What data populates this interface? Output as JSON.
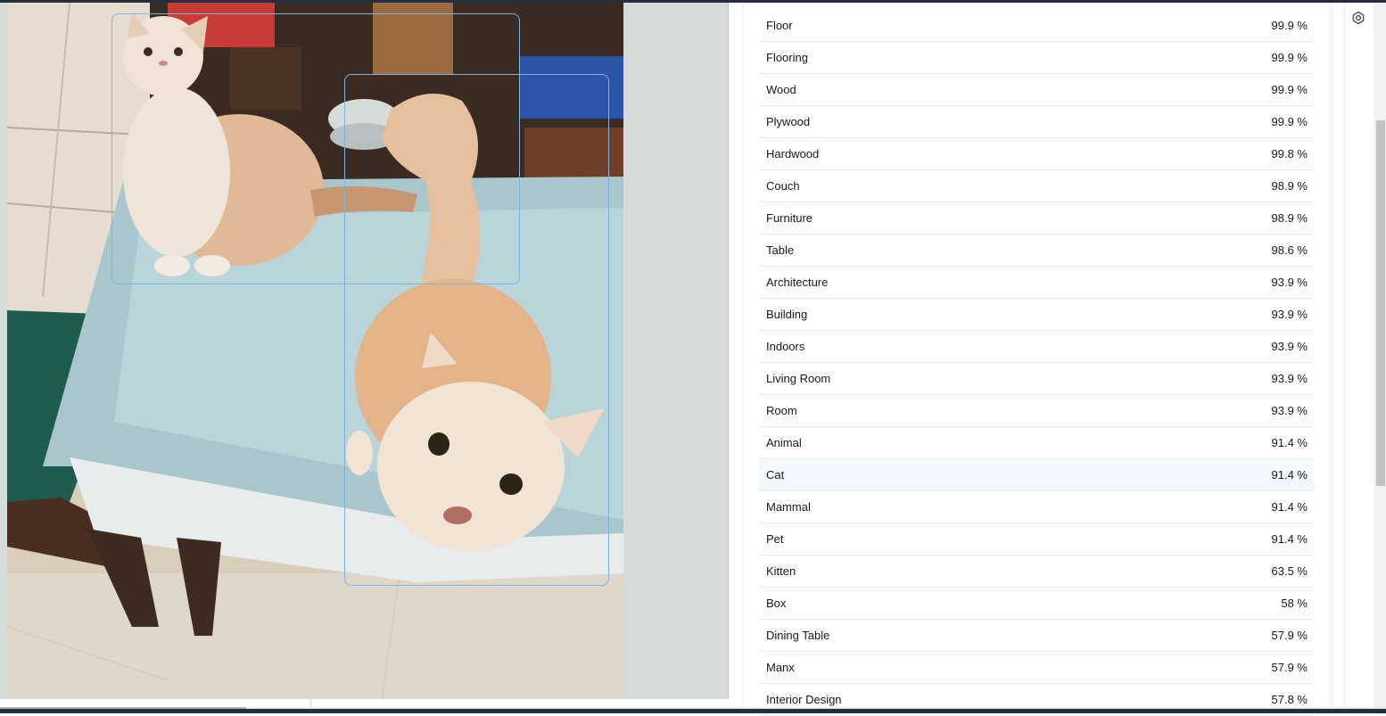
{
  "image_panel": {
    "description_icon": "photo-cats-on-table",
    "detected_boxes": [
      "cat-box-1",
      "cat-box-2"
    ]
  },
  "labels": [
    {
      "name": "Floor",
      "confidence": "99.9 %"
    },
    {
      "name": "Flooring",
      "confidence": "99.9 %"
    },
    {
      "name": "Wood",
      "confidence": "99.9 %"
    },
    {
      "name": "Plywood",
      "confidence": "99.9 %"
    },
    {
      "name": "Hardwood",
      "confidence": "99.8 %"
    },
    {
      "name": "Couch",
      "confidence": "98.9 %"
    },
    {
      "name": "Furniture",
      "confidence": "98.9 %"
    },
    {
      "name": "Table",
      "confidence": "98.6 %"
    },
    {
      "name": "Architecture",
      "confidence": "93.9 %"
    },
    {
      "name": "Building",
      "confidence": "93.9 %"
    },
    {
      "name": "Indoors",
      "confidence": "93.9 %"
    },
    {
      "name": "Living Room",
      "confidence": "93.9 %"
    },
    {
      "name": "Room",
      "confidence": "93.9 %"
    },
    {
      "name": "Animal",
      "confidence": "91.4 %"
    },
    {
      "name": "Cat",
      "confidence": "91.4 %"
    },
    {
      "name": "Mammal",
      "confidence": "91.4 %"
    },
    {
      "name": "Pet",
      "confidence": "91.4 %"
    },
    {
      "name": "Kitten",
      "confidence": "63.5 %"
    },
    {
      "name": "Box",
      "confidence": "58 %"
    },
    {
      "name": "Dining Table",
      "confidence": "57.9 %"
    },
    {
      "name": "Manx",
      "confidence": "57.9 %"
    },
    {
      "name": "Interior Design",
      "confidence": "57.8 %"
    }
  ],
  "highlighted_label": "Cat",
  "colors": {
    "bounding_box": "#7fb3e6",
    "highlight_row": "#f2f8fd",
    "header_bar": "#232f3e"
  },
  "icons": {
    "settings": "gear-icon"
  }
}
